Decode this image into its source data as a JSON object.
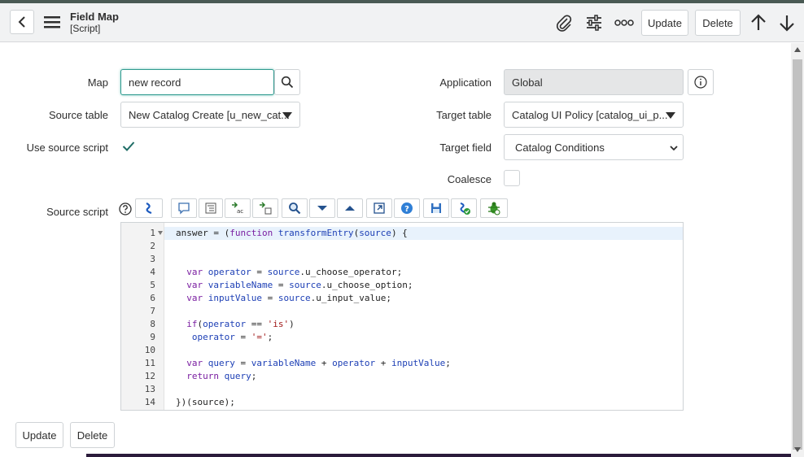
{
  "header": {
    "title": "Field Map",
    "subtitle": "[Script]",
    "update_label": "Update",
    "delete_label": "Delete"
  },
  "form": {
    "map_label": "Map",
    "map_value": "new record",
    "source_table_label": "Source table",
    "source_table_value": "New Catalog Create [u_new_cat...",
    "use_source_script_label": "Use source script",
    "use_source_script_checked": true,
    "application_label": "Application",
    "application_value": "Global",
    "target_table_label": "Target table",
    "target_table_value": "Catalog UI Policy [catalog_ui_p...",
    "target_field_label": "Target field",
    "target_field_value": "Catalog Conditions",
    "coalesce_label": "Coalesce",
    "source_script_label": "Source script"
  },
  "editor": {
    "line_numbers": [
      "1",
      "2",
      "3",
      "4",
      "5",
      "6",
      "7",
      "8",
      "9",
      "10",
      "11",
      "12",
      "13",
      "14"
    ]
  },
  "footer": {
    "update_label": "Update",
    "delete_label": "Delete"
  },
  "colors": {
    "accent": "#293e40",
    "focus_border": "#2e9a8e",
    "keyword": "#7a1ea1",
    "variable": "#1d3fb5",
    "string": "#a11a1a"
  }
}
